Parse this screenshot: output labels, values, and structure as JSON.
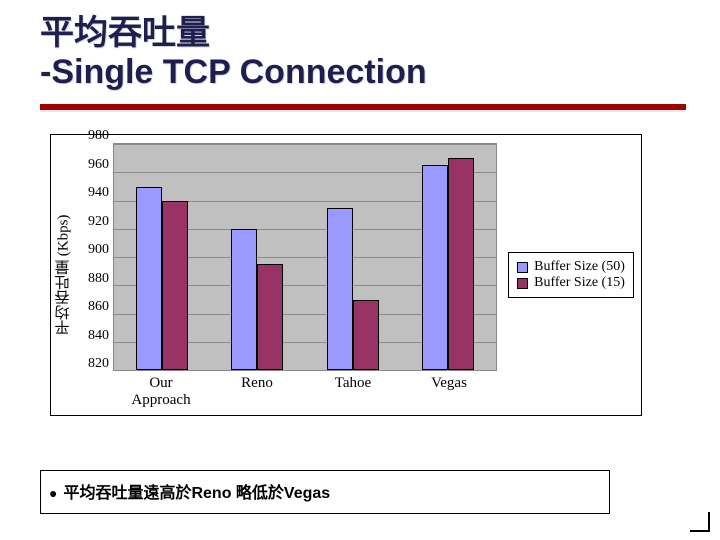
{
  "title_line1": "平均吞吐量",
  "title_line2": "-Single TCP Connection",
  "caption": "平均吞吐量遠高於Reno 略低於Vegas",
  "legend": {
    "series1": "Buffer Size (50)",
    "series2": "Buffer Size (15)"
  },
  "chart_data": {
    "type": "bar",
    "ylabel": "平均吞吐量 (Kbps)",
    "xlabel": "",
    "ylim": [
      820,
      980
    ],
    "yticks": [
      980,
      960,
      940,
      920,
      900,
      880,
      860,
      840,
      820
    ],
    "categories": [
      "Our Approach",
      "Reno",
      "Tahoe",
      "Vegas"
    ],
    "series": [
      {
        "name": "Buffer Size (50)",
        "values": [
          950,
          920,
          935,
          965
        ]
      },
      {
        "name": "Buffer Size (15)",
        "values": [
          940,
          895,
          870,
          970
        ]
      }
    ]
  }
}
